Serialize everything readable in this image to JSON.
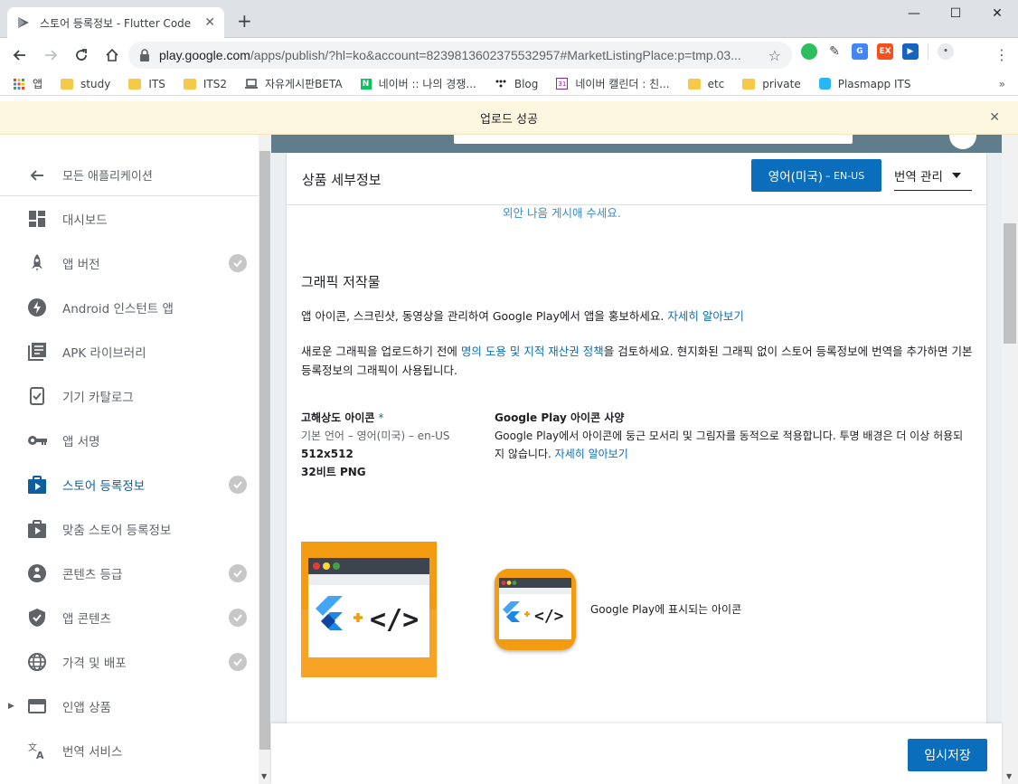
{
  "browser": {
    "tab_title": "스토어 등록정보 - Flutter Code",
    "url_host": "play.google.com",
    "url_rest": "/apps/publish/?hl=ko&account=8239813602375532957#MarketListingPlace:p=tmp.03...",
    "bookmarks": [
      {
        "label": "앱",
        "icon": "apps-grid-icon"
      },
      {
        "label": "study",
        "icon": "folder-icon"
      },
      {
        "label": "ITS",
        "icon": "folder-icon"
      },
      {
        "label": "ITS2",
        "icon": "folder-icon"
      },
      {
        "label": "자유게시판BETA",
        "icon": "laptop-icon"
      },
      {
        "label": "네이버 :: 나의 경쟁...",
        "icon": "naver-icon"
      },
      {
        "label": "Blog",
        "icon": "dots-icon"
      },
      {
        "label": "네이버 캘린더 : 친...",
        "icon": "calendar-icon"
      },
      {
        "label": "etc",
        "icon": "folder-icon"
      },
      {
        "label": "private",
        "icon": "folder-icon"
      },
      {
        "label": "Plasmapp ITS",
        "icon": "plasmapp-icon"
      }
    ]
  },
  "notice": {
    "text": "업로드 성공"
  },
  "sidebar": {
    "back_label": "모든 애플리케이션",
    "items": [
      {
        "label": "대시보드",
        "icon": "dashboard-icon",
        "checked": false
      },
      {
        "label": "앱 버전",
        "icon": "rocket-icon",
        "checked": true
      },
      {
        "label": "Android 인스턴트 앱",
        "icon": "bolt-icon",
        "checked": false
      },
      {
        "label": "APK 라이브러리",
        "icon": "library-icon",
        "checked": false
      },
      {
        "label": "기기 카탈로그",
        "icon": "device-check-icon",
        "checked": false
      },
      {
        "label": "앱 서명",
        "icon": "key-icon",
        "checked": false
      },
      {
        "label": "스토어 등록정보",
        "icon": "store-play-icon",
        "checked": true,
        "active": true
      },
      {
        "label": "맞춤 스토어 등록정보",
        "icon": "custom-store-icon",
        "checked": false
      },
      {
        "label": "콘텐츠 등급",
        "icon": "rating-icon",
        "checked": true
      },
      {
        "label": "앱 콘텐츠",
        "icon": "shield-icon",
        "checked": true
      },
      {
        "label": "가격 및 배포",
        "icon": "globe-icon",
        "checked": true
      },
      {
        "label": "인앱 상품",
        "icon": "credit-card-icon",
        "checked": false
      },
      {
        "label": "번역 서비스",
        "icon": "translate-icon",
        "checked": false
      }
    ]
  },
  "card": {
    "title": "상품 세부정보",
    "lang_button": "영어(미국)",
    "lang_code": "– EN-US",
    "translate_dropdown": "번역 관리",
    "cut_text": "외안 나음 게시애 수세요.",
    "section_title": "그래픽 저작물",
    "para1_text": "앱 아이콘, 스크린샷, 동영상을 관리하여 Google Play에서 앱을 홍보하세요. ",
    "para1_link": "자세히 알아보기",
    "para2_a": "새로운 그래픽을 업로드하기 전에 ",
    "para2_link": "명의 도용 및 지적 재산권 정책",
    "para2_b": "을 검토하세요. 현지화된 그래픽 없이 스토어 등록정보에 번역을 추가하면 기본 등록정보의 그래픽이 사용됩니다.",
    "icon_label": "고해상도 아이콘",
    "icon_required": "*",
    "icon_lang": "기본 언어 – 영어(미국) – en-US",
    "icon_size": "512x512",
    "icon_format": "32비트 PNG",
    "gp_label": "Google Play 아이콘 사양",
    "gp_text": "Google Play에서 아이콘에 둥근 모서리 및 그림자를 동적으로 적용합니다. 투명 배경은 더 이상 허용되지 않습니다. ",
    "gp_link": "자세히 알아보기",
    "gp_caption": "Google Play에 표시되는 아이콘",
    "icon_art_text": "</>"
  },
  "footer": {
    "save_label": "임시저장"
  },
  "colors": {
    "accent": "#0a6ebd",
    "icon_bg": "#f39c12",
    "flutter_blue": "#42a5f5"
  }
}
